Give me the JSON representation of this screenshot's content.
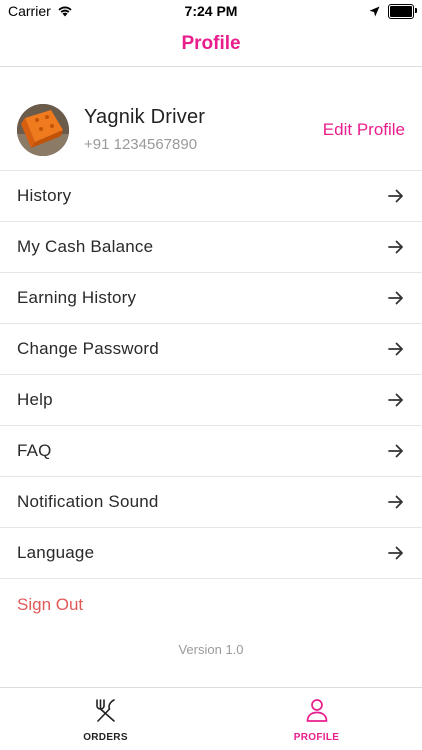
{
  "status_bar": {
    "carrier": "Carrier",
    "time": "7:24 PM",
    "icons": [
      "wifi-icon",
      "location-arrow-icon",
      "battery-icon"
    ]
  },
  "header": {
    "title": "Profile"
  },
  "profile": {
    "name": "Yagnik Driver",
    "phone": "+91 1234567890",
    "edit_label": "Edit Profile"
  },
  "menu": {
    "items": [
      {
        "label": "History"
      },
      {
        "label": "My Cash Balance"
      },
      {
        "label": "Earning History"
      },
      {
        "label": "Change Password"
      },
      {
        "label": "Help"
      },
      {
        "label": "FAQ"
      },
      {
        "label": "Notification Sound"
      },
      {
        "label": "Language"
      }
    ],
    "sign_out_label": "Sign Out"
  },
  "footer": {
    "version": "Version 1.0"
  },
  "tab_bar": {
    "tabs": [
      {
        "label": "ORDERS",
        "icon": "fork-knife-icon",
        "active": false
      },
      {
        "label": "PROFILE",
        "icon": "person-icon",
        "active": true
      }
    ]
  },
  "colors": {
    "accent": "#e91e8c",
    "sign_out": "#e05a5a",
    "muted_text": "#9a9a9a"
  }
}
